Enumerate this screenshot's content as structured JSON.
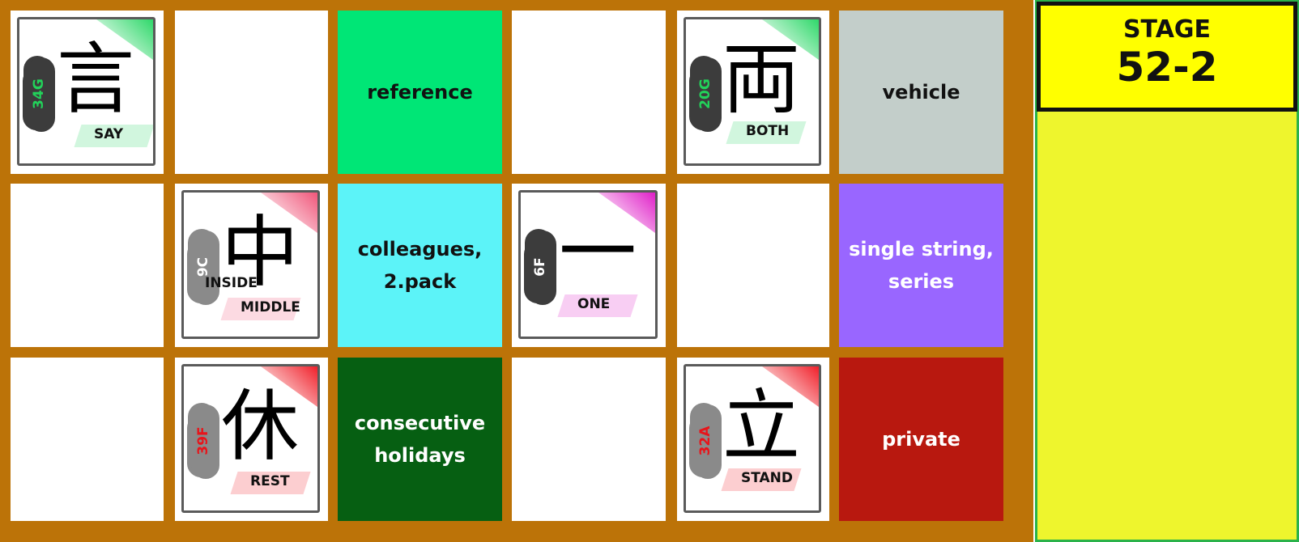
{
  "stage": {
    "label": "STAGE",
    "number": "52-2"
  },
  "colors": {
    "board": "#bc7308",
    "panel": "#eef52d",
    "stage_box": "#ffff00",
    "green_light": "#00e676",
    "gray": "#c3ceca",
    "cyan": "#5cf3f8",
    "purple": "#9966ff",
    "green_dark": "#065f12",
    "red": "#b8180f"
  },
  "grid": [
    [
      {
        "type": "card",
        "kanji": "言",
        "code": "34G",
        "code_color": "#22d35a",
        "cloud": "dark",
        "labels": [
          "SAY"
        ],
        "accent": "#2fd86a",
        "layout": "say"
      },
      {
        "type": "empty"
      },
      {
        "type": "word",
        "text": "reference",
        "bg": "#00e676",
        "fg": "#111111"
      },
      {
        "type": "empty"
      },
      {
        "type": "card",
        "kanji": "両",
        "code": "20G",
        "code_color": "#22d35a",
        "cloud": "dark",
        "labels": [
          "BOTH"
        ],
        "accent": "#2fd86a",
        "layout": "both"
      },
      {
        "type": "word",
        "text": "vehicle",
        "bg": "#c3ceca",
        "fg": "#111111"
      }
    ],
    [
      {
        "type": "empty"
      },
      {
        "type": "card",
        "kanji": "中",
        "code": "9C",
        "code_color": "#ffffff",
        "cloud": "light",
        "labels": [
          "INSIDE",
          "MIDDLE"
        ],
        "accent": "#f0567a",
        "layout": "inside"
      },
      {
        "type": "word",
        "text": "colleagues,\n2.pack",
        "bg": "#5cf3f8",
        "fg": "#111111"
      },
      {
        "type": "card",
        "kanji": "一",
        "code": "6F",
        "code_color": "#ffffff",
        "cloud": "dark",
        "labels": [
          "ONE"
        ],
        "accent": "#e020c8",
        "layout": "one"
      },
      {
        "type": "empty"
      },
      {
        "type": "word",
        "text": "single string,\nseries",
        "bg": "#9966ff",
        "fg": "#ffffff"
      }
    ],
    [
      {
        "type": "empty"
      },
      {
        "type": "card",
        "kanji": "休",
        "code": "39F",
        "code_color": "#e8141a",
        "cloud": "light",
        "labels": [
          "REST"
        ],
        "accent": "#f0202a",
        "layout": "rest"
      },
      {
        "type": "word",
        "text": "consecutive\nholidays",
        "bg": "#065f12",
        "fg": "#ffffff"
      },
      {
        "type": "empty"
      },
      {
        "type": "card",
        "kanji": "立",
        "code": "32A",
        "code_color": "#e8141a",
        "cloud": "light",
        "labels": [
          "STAND"
        ],
        "accent": "#f0202a",
        "layout": "stand"
      },
      {
        "type": "word",
        "text": "private",
        "bg": "#b8180f",
        "fg": "#ffffff"
      }
    ]
  ]
}
